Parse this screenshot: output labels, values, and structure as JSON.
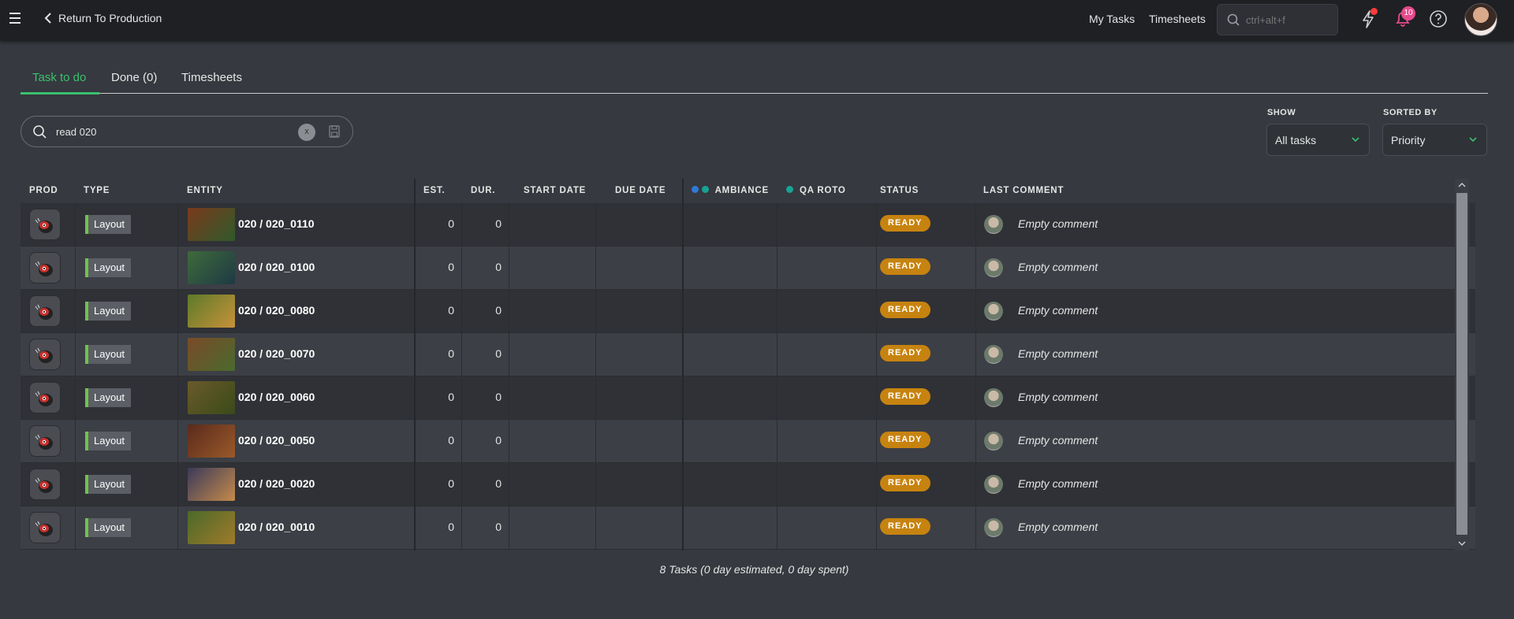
{
  "topbar": {
    "back_label": "Return To Production",
    "my_tasks": "My Tasks",
    "timesheets": "Timesheets",
    "search_placeholder": "ctrl+alt+f",
    "notification_count": "10"
  },
  "tabs": [
    {
      "label": "Task to do",
      "active": true
    },
    {
      "label": "Done (0)",
      "active": false
    },
    {
      "label": "Timesheets",
      "active": false
    }
  ],
  "search": {
    "value": "read 020",
    "clear_label": "x"
  },
  "filters": {
    "show_label": "SHOW",
    "show_value": "All tasks",
    "sort_label": "SORTED BY",
    "sort_value": "Priority"
  },
  "columns": {
    "prod": "PROD",
    "type": "TYPE",
    "entity": "ENTITY",
    "est": "EST.",
    "dur": "DUR.",
    "start_date": "START DATE",
    "due_date": "DUE DATE",
    "ambiance": "AMBIANCE",
    "qa_roto": "QA ROTO",
    "status": "STATUS",
    "last_comment": "LAST COMMENT"
  },
  "colors": {
    "accent_green": "#3ac06f",
    "status_ready": "#c7830f",
    "ambiance_dot_1": "#2f7ad6",
    "ambiance_dot_2": "#17a396",
    "qa_roto_dot": "#17a396",
    "type_bar": "#6fc34b"
  },
  "rows": [
    {
      "type": "Layout",
      "entity": "020 / 020_0110",
      "est": "0",
      "dur": "0",
      "status": "READY",
      "comment": "Empty comment"
    },
    {
      "type": "Layout",
      "entity": "020 / 020_0100",
      "est": "0",
      "dur": "0",
      "status": "READY",
      "comment": "Empty comment"
    },
    {
      "type": "Layout",
      "entity": "020 / 020_0080",
      "est": "0",
      "dur": "0",
      "status": "READY",
      "comment": "Empty comment"
    },
    {
      "type": "Layout",
      "entity": "020 / 020_0070",
      "est": "0",
      "dur": "0",
      "status": "READY",
      "comment": "Empty comment"
    },
    {
      "type": "Layout",
      "entity": "020 / 020_0060",
      "est": "0",
      "dur": "0",
      "status": "READY",
      "comment": "Empty comment"
    },
    {
      "type": "Layout",
      "entity": "020 / 020_0050",
      "est": "0",
      "dur": "0",
      "status": "READY",
      "comment": "Empty comment"
    },
    {
      "type": "Layout",
      "entity": "020 / 020_0020",
      "est": "0",
      "dur": "0",
      "status": "READY",
      "comment": "Empty comment"
    },
    {
      "type": "Layout",
      "entity": "020 / 020_0010",
      "est": "0",
      "dur": "0",
      "status": "READY",
      "comment": "Empty comment"
    }
  ],
  "footer": "8 Tasks (0 day estimated, 0 day spent)"
}
